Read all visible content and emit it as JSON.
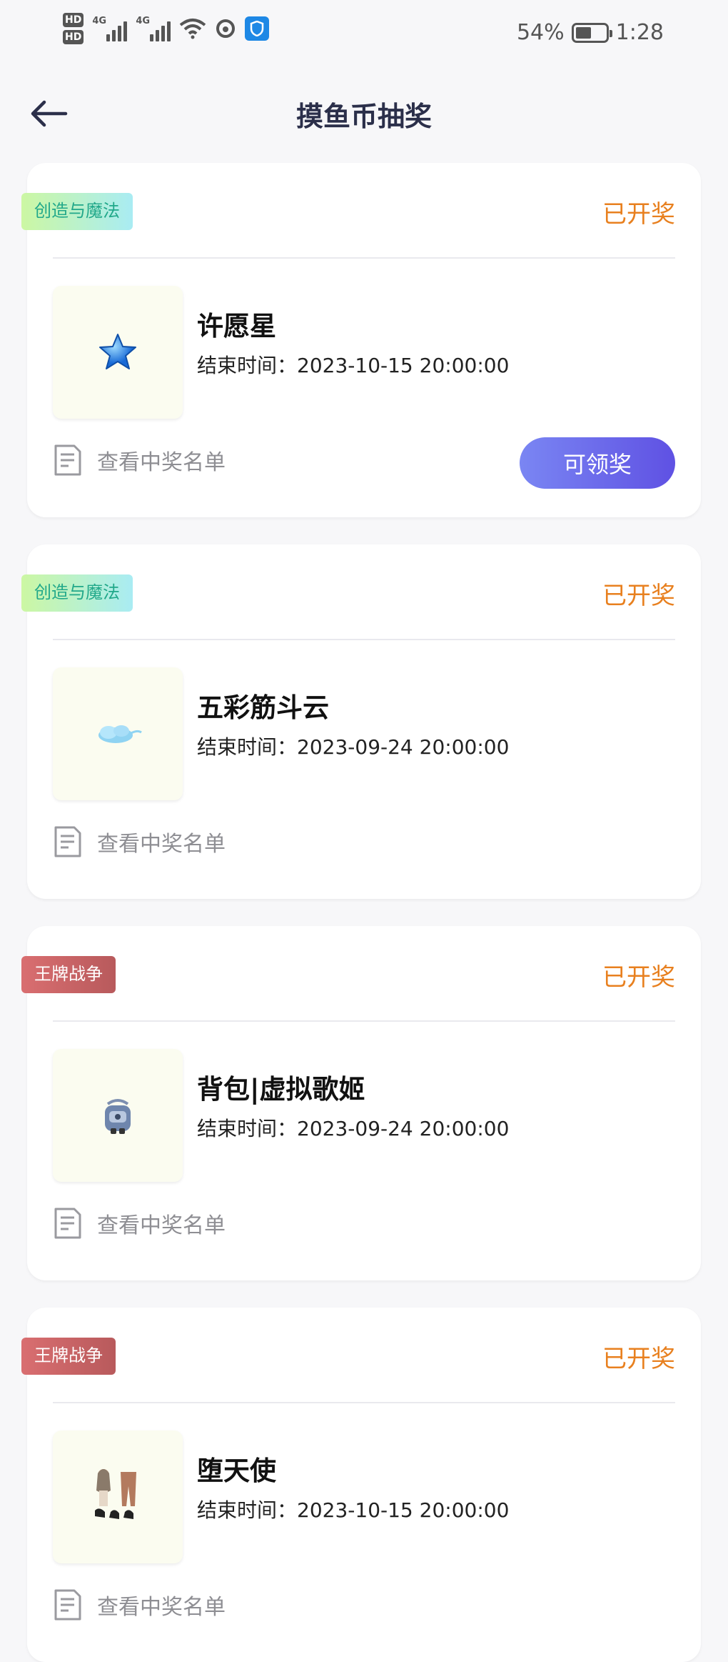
{
  "status_bar": {
    "hd1": "HD",
    "hd2": "HD",
    "net1": "4G",
    "net2": "4G",
    "battery": "54%",
    "battery_level": 0.54,
    "time": "1:28"
  },
  "header": {
    "title": "摸鱼币抽奖"
  },
  "common": {
    "end_time_label": "结束时间：",
    "winners_label": "查看中奖名单"
  },
  "cards": [
    {
      "category": "创造与魔法",
      "status": "已开奖",
      "name": "许愿星",
      "end_time": "2023-10-15 20:00:00",
      "claim_label": "可领奖",
      "image_icon": "blue-star-icon"
    },
    {
      "category": "创造与魔法",
      "status": "已开奖",
      "name": "五彩筋斗云",
      "end_time": "2023-09-24 20:00:00",
      "image_icon": "cloud-icon"
    },
    {
      "category": "王牌战争",
      "status": "已开奖",
      "name": "背包|虚拟歌姬",
      "end_time": "2023-09-24 20:00:00",
      "image_icon": "backpack-icon"
    },
    {
      "category": "王牌战争",
      "status": "已开奖",
      "name": "堕天使",
      "end_time": "2023-10-15 20:00:00",
      "image_icon": "outfit-icon"
    }
  ],
  "colors": {
    "status_orange": "#e8801f",
    "claim_gradient_start": "#7a86f3",
    "claim_gradient_end": "#5f51e3",
    "tag_green_text": "#21a88a",
    "tag_red_bg": "#c96365"
  }
}
